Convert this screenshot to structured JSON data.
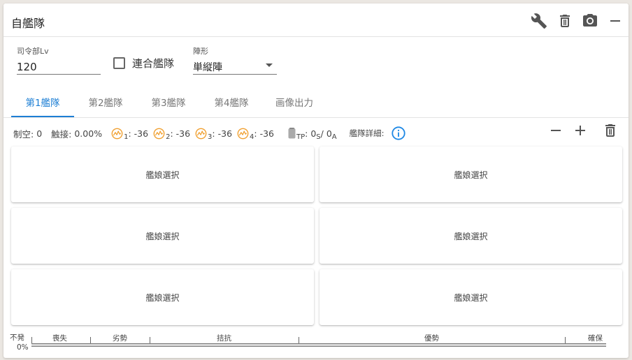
{
  "header": {
    "title": "自艦隊",
    "icons": [
      "wrench-icon",
      "trash-icon",
      "camera-icon",
      "minimize-icon"
    ]
  },
  "settings": {
    "admiral_lv_label": "司令部Lv",
    "admiral_lv_value": "120",
    "combined_label": "連合艦隊",
    "combined_checked": false,
    "formation_label": "陣形",
    "formation_value": "単縦陣"
  },
  "tabs": [
    {
      "label": "第1艦隊",
      "active": true
    },
    {
      "label": "第2艦隊",
      "active": false
    },
    {
      "label": "第3艦隊",
      "active": false
    },
    {
      "label": "第4艦隊",
      "active": false
    },
    {
      "label": "画像出力",
      "active": false
    }
  ],
  "stats": {
    "air_label": "制空:",
    "air_value": "0",
    "contact_label": "触接:",
    "contact_value": "0.00%",
    "cond": [
      {
        "sub": "1",
        "value": ": -36"
      },
      {
        "sub": "2",
        "value": ": -36"
      },
      {
        "sub": "3",
        "value": ": -36"
      },
      {
        "sub": "4",
        "value": ": -36"
      }
    ],
    "tp_sub": "TP",
    "tp_s_prefix": ": 0",
    "tp_s_sub": "S",
    "tp_a_prefix": " / 0",
    "tp_a_sub": "A",
    "fleet_detail_label": "艦隊詳細:"
  },
  "ships": [
    {
      "label": "艦娘選択"
    },
    {
      "label": "艦娘選択"
    },
    {
      "label": "艦娘選択"
    },
    {
      "label": "艦娘選択"
    },
    {
      "label": "艦娘選択"
    },
    {
      "label": "艦娘選択"
    }
  ],
  "air_state": {
    "no_sortie_label": "不発",
    "percent": "0%",
    "labels": [
      "喪失",
      "劣勢",
      "拮抗",
      "優勢",
      "確保"
    ]
  },
  "colors": {
    "accent": "#1e7fd4",
    "cond_icon": "#f0a030",
    "info": "#1e88e5"
  }
}
